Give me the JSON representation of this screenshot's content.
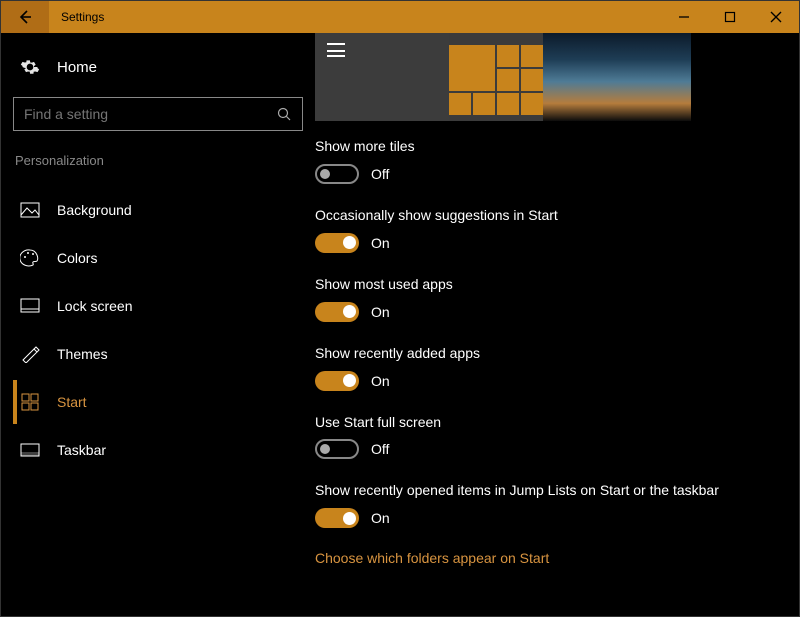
{
  "colors": {
    "accent": "#c8841c"
  },
  "titlebar": {
    "title": "Settings"
  },
  "sidebar": {
    "home": "Home",
    "search_placeholder": "Find a setting",
    "category": "Personalization",
    "items": [
      {
        "label": "Background",
        "icon": "image-icon"
      },
      {
        "label": "Colors",
        "icon": "palette-icon"
      },
      {
        "label": "Lock screen",
        "icon": "lockscreen-icon"
      },
      {
        "label": "Themes",
        "icon": "themes-icon"
      },
      {
        "label": "Start",
        "icon": "start-icon",
        "active": true
      },
      {
        "label": "Taskbar",
        "icon": "taskbar-icon"
      }
    ]
  },
  "settings": [
    {
      "label": "Show more tiles",
      "on": false,
      "state": "Off"
    },
    {
      "label": "Occasionally show suggestions in Start",
      "on": true,
      "state": "On"
    },
    {
      "label": "Show most used apps",
      "on": true,
      "state": "On"
    },
    {
      "label": "Show recently added apps",
      "on": true,
      "state": "On"
    },
    {
      "label": "Use Start full screen",
      "on": false,
      "state": "Off"
    },
    {
      "label": "Show recently opened items in Jump Lists on Start or the taskbar",
      "on": true,
      "state": "On"
    }
  ],
  "link": "Choose which folders appear on Start"
}
